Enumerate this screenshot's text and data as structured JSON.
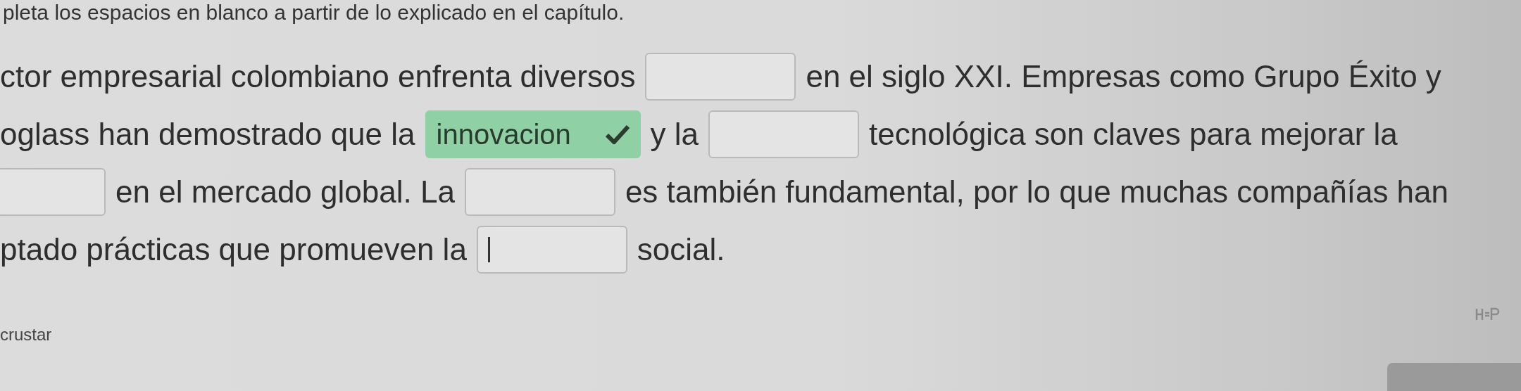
{
  "instruction": "pleta los espacios en blanco a partir de lo explicado en el capítulo.",
  "lines": [
    {
      "segments": [
        {
          "kind": "text",
          "text": "ctor empresarial colombiano enfrenta diversos"
        },
        {
          "kind": "blank",
          "correct": false,
          "focused": false
        },
        {
          "kind": "text",
          "text": "en el siglo XXI. Empresas como Grupo Éxito y"
        }
      ]
    },
    {
      "segments": [
        {
          "kind": "text",
          "text": "oglass han demostrado que la"
        },
        {
          "kind": "blank",
          "value": "innovacion",
          "correct": true,
          "focused": false
        },
        {
          "kind": "text",
          "text": "y la"
        },
        {
          "kind": "blank",
          "correct": false,
          "focused": false
        },
        {
          "kind": "text",
          "text": "tecnológica son claves para mejorar la"
        }
      ]
    },
    {
      "segments": [
        {
          "kind": "blank",
          "correct": false,
          "focused": false
        },
        {
          "kind": "text",
          "text": "en el mercado global. La"
        },
        {
          "kind": "blank",
          "correct": false,
          "focused": false
        },
        {
          "kind": "text",
          "text": "es también fundamental, por lo que muchas compañías han"
        }
      ]
    },
    {
      "segments": [
        {
          "kind": "text",
          "text": "ptado prácticas que promueven la"
        },
        {
          "kind": "blank",
          "correct": false,
          "focused": true
        },
        {
          "kind": "text",
          "text": "social."
        }
      ]
    }
  ],
  "footer": {
    "label": "crustar"
  }
}
